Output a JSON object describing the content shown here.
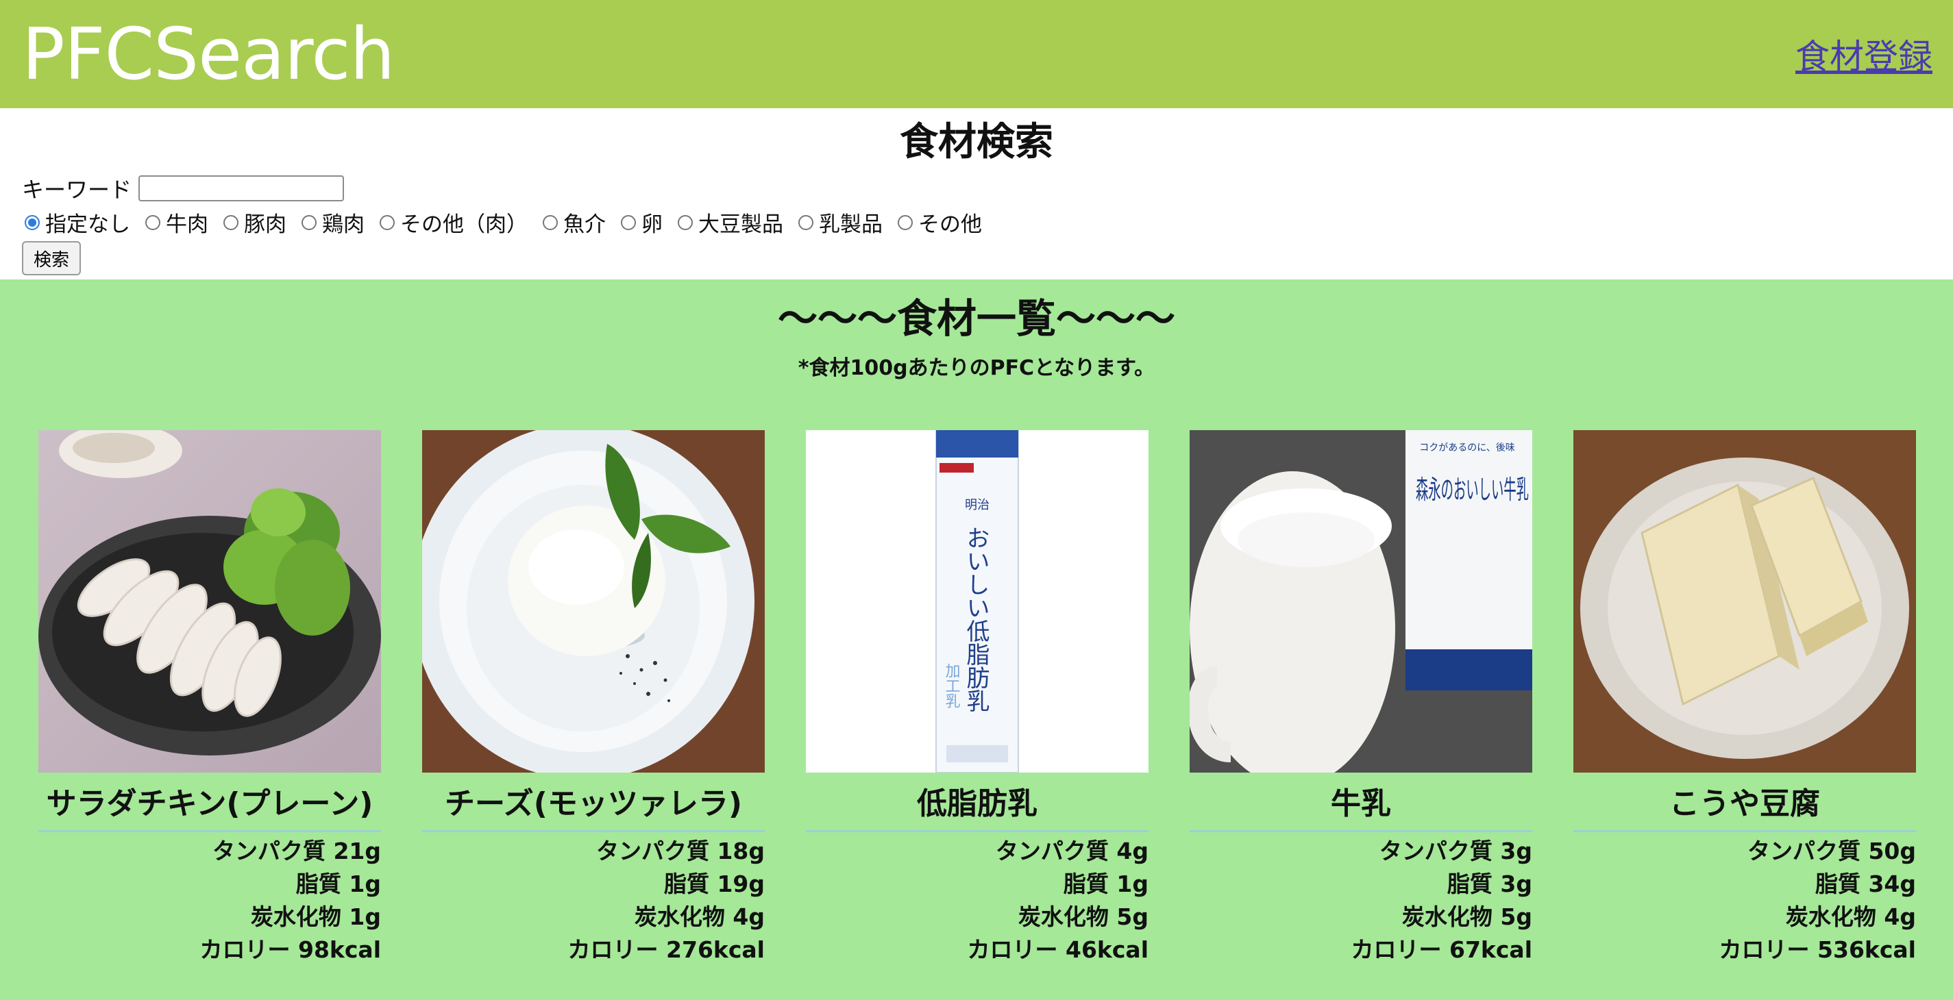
{
  "header": {
    "logo": "PFCSearch",
    "register_link": "食材登録"
  },
  "search": {
    "title": "食材検索",
    "keyword_label": "キーワード",
    "keyword_value": "",
    "categories": [
      "指定なし",
      "牛肉",
      "豚肉",
      "鶏肉",
      "その他（肉）",
      "魚介",
      "卵",
      "大豆製品",
      "乳製品",
      "その他"
    ],
    "selected": "指定なし",
    "button": "検索"
  },
  "list": {
    "title": "〜〜〜食材一覧〜〜〜",
    "note": "*食材100gあたりのPFCとなります。",
    "items": [
      {
        "name": "サラダチキン(プレーン)",
        "protein": "タンパク質 21g",
        "fat": "脂質 1g",
        "carb": "炭水化物 1g",
        "kcal": "カロリー 98kcal"
      },
      {
        "name": "チーズ(モッツァレラ)",
        "protein": "タンパク質 18g",
        "fat": "脂質 19g",
        "carb": "炭水化物 4g",
        "kcal": "カロリー 276kcal"
      },
      {
        "name": "低脂肪乳",
        "protein": "タンパク質 4g",
        "fat": "脂質 1g",
        "carb": "炭水化物 5g",
        "kcal": "カロリー 46kcal",
        "package": {
          "brand": "明治",
          "text": "おいしい低脂肪乳",
          "sub": "加工乳"
        }
      },
      {
        "name": "牛乳",
        "protein": "タンパク質 3g",
        "fat": "脂質 3g",
        "carb": "炭水化物 5g",
        "kcal": "カロリー 67kcal",
        "package": {
          "tag": "コクがあるのに、後味",
          "text": "森永のおいしい牛乳"
        }
      },
      {
        "name": "こうや豆腐",
        "protein": "タンパク質 50g",
        "fat": "脂質 34g",
        "carb": "炭水化物 4g",
        "kcal": "カロリー 536kcal"
      }
    ]
  },
  "colors": {
    "header": "#a8cd50",
    "list_bg": "#a5e898",
    "link": "#4b3bb0",
    "radio_selected": "#2e7be0"
  }
}
